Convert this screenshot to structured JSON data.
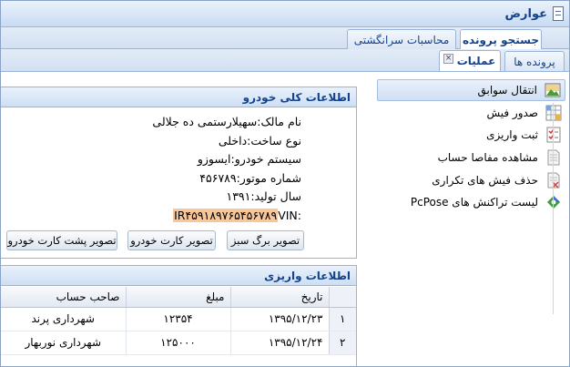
{
  "window": {
    "title": "عوارض",
    "icon": "document-icon"
  },
  "top_tabs": [
    {
      "label": "جستجو پرونده",
      "active": true
    },
    {
      "label": "محاسبات سرانگشتی",
      "active": false
    }
  ],
  "sub_tabs": [
    {
      "label": "پرونده ها",
      "active": false
    },
    {
      "label": "عملیات",
      "active": true,
      "closable": true
    }
  ],
  "side_menu": [
    {
      "label": "انتقال سوابق",
      "icon": "landscape-icon",
      "selected": true
    },
    {
      "label": "صدور فیش",
      "icon": "grid-table-icon",
      "selected": false
    },
    {
      "label": "ثبت واریزی",
      "icon": "checklist-icon",
      "selected": false
    },
    {
      "label": "مشاهده مفاصا حساب",
      "icon": "document-view-icon",
      "selected": false
    },
    {
      "label": "حذف فیش های تکراری",
      "icon": "document-delete-icon",
      "selected": false
    },
    {
      "label": "لیست تراکنش های PcPose",
      "icon": "puzzle-icon",
      "selected": false
    }
  ],
  "vehicle_info": {
    "header": "اطلاعات کلی خودرو",
    "lines": [
      "نام مالک:سهیلارستمی ده جلالی",
      "نوع ساخت:داخلی",
      "سیستم خودرو:ایسوزو",
      "شماره موتور:۴۵۶۷۸۹",
      "سال تولید:۱۳۹۱"
    ],
    "vin_label": "VIN:",
    "vin_value": "IR۴۵۹۱۸۹۷۶۵۴۵۶۷۸۹",
    "buttons": [
      "تصویر برگ سبز",
      "تصویر کارت خودرو",
      "تصویر پشت کارت خودرو"
    ]
  },
  "payments": {
    "header": "اطلاعات واریزی",
    "columns": [
      "تاریخ",
      "مبلغ",
      "صاحب حساب"
    ],
    "rows": [
      {
        "n": "۱",
        "date": "۱۳۹۵/۱۲/۲۳",
        "amount": "۱۲۳۵۴",
        "owner": "شهرداری پرند"
      },
      {
        "n": "۲",
        "date": "۱۳۹۵/۱۲/۲۴",
        "amount": "۱۲۵۰۰۰",
        "owner": "شهرداری نوربهار"
      }
    ]
  }
}
